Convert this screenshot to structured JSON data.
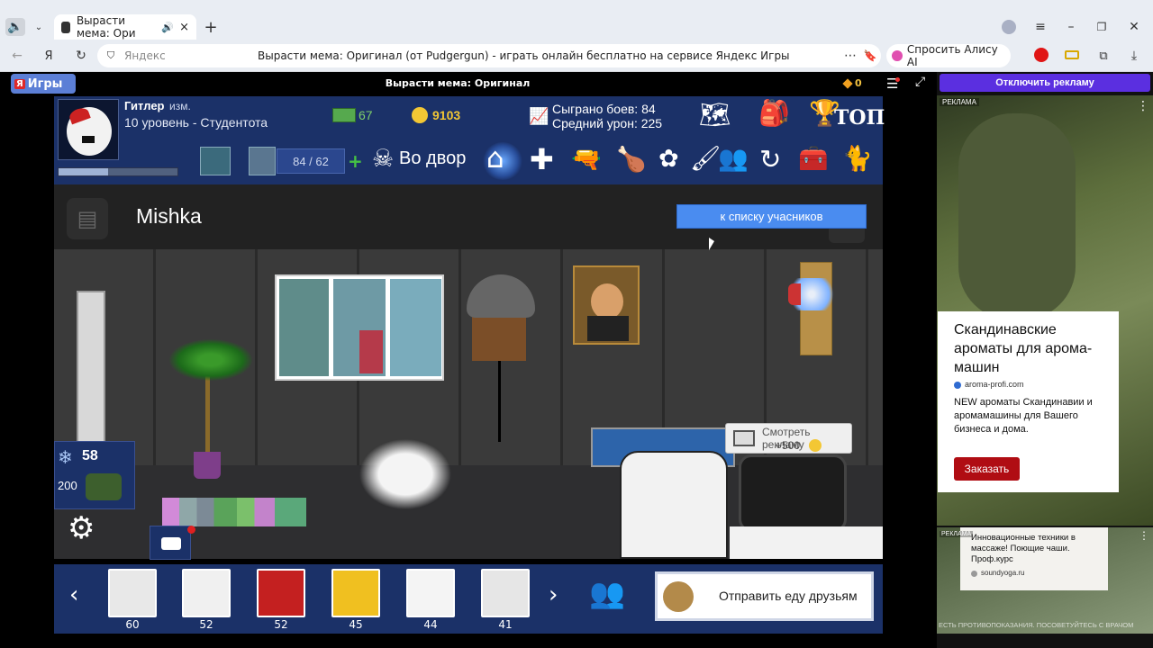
{
  "browser": {
    "tab_title": "Вырасти мема: Ори",
    "address_host": "Яндекс",
    "page_title": "Вырасти мема: Оригинал (от Pudgergun) - играть онлайн бесплатно на сервисе Яндекс Игры",
    "alice_label": "Спросить Алису AI"
  },
  "site": {
    "logo_label": "Игры",
    "game_title": "Вырасти мема: Оригинал",
    "coins": "0",
    "disable_ads": "Отключить рекламу"
  },
  "player": {
    "name": "Гитлер",
    "edit": "изм.",
    "level": "10 уровень - Студентота",
    "money": "67",
    "gold": "9103",
    "battles_label": "Сыграно боев: 84",
    "damage_label": "Средний урон: 225",
    "top_label": "ТОП",
    "energy": "84 / 62",
    "yard_label": "Во двор",
    "xp_fraction": 0.42
  },
  "room": {
    "owner": "Mishka",
    "list_button": "к списку учасников",
    "snowflakes": "58",
    "cost": "200",
    "ad_watch_label": "Смотреть рекламу",
    "ad_reward": "+500"
  },
  "friends": [
    {
      "level": "60"
    },
    {
      "level": "52"
    },
    {
      "level": "52"
    },
    {
      "level": "45"
    },
    {
      "level": "44"
    },
    {
      "level": "41"
    }
  ],
  "send_food": "Отправить еду друзьям",
  "ads": {
    "label": "РЕКЛАМА",
    "ad1_title": "Скандинавские ароматы для арома-машин",
    "ad1_domain": "aroma-profi.com",
    "ad1_text": "NEW ароматы Скандинавии и аромамашины для Вашего бизнеса и дома.",
    "ad1_button": "Заказать",
    "ad2_title": "Инновационные техники в массаже! Поющие чаши. Проф.курс",
    "ad2_domain": "soundyoga.ru",
    "ad2_footer": "ЕСТЬ ПРОТИВОПОКАЗАНИЯ. ПОСОВЕТУЙТЕСЬ С ВРАЧОМ"
  },
  "colors": {
    "header_blue": "#1b3168",
    "accent_blue": "#4a8cf0",
    "ad_button": "#b00d13",
    "purple": "#5b2fe0"
  }
}
